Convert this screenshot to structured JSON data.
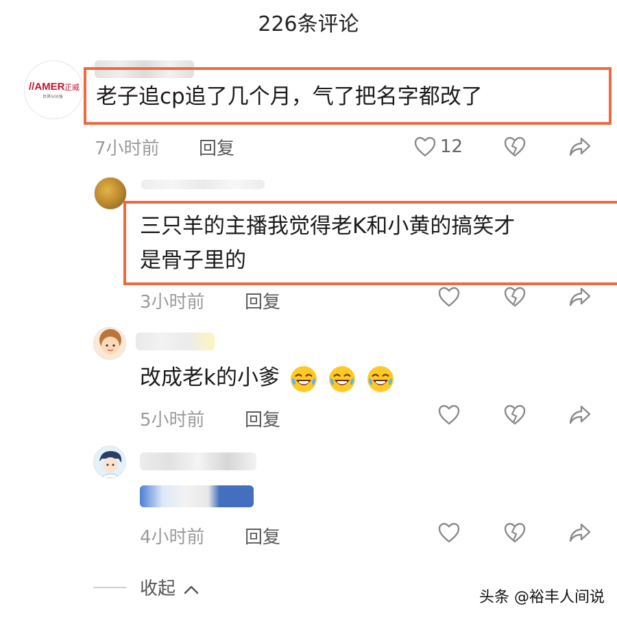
{
  "header": {
    "title": "226条评论"
  },
  "comments": [
    {
      "text": "老子追cp追了几个月，气了把名字都改了",
      "time": "7小时前",
      "reply": "回复",
      "likes": "12",
      "avatar_logo": "MER 正威",
      "avatar_sub": "世界500强"
    },
    {
      "line1": "三只羊的主播我觉得老K和小黄的搞笑才",
      "line2": "是骨子里的",
      "time": "3小时前",
      "reply": "回复"
    },
    {
      "text": "改成老k的小爹",
      "time": "5小时前",
      "reply": "回复",
      "emoji": "laughing-crying-emoji"
    },
    {
      "time": "4小时前",
      "reply": "回复"
    }
  ],
  "footer": {
    "collapse": "收起",
    "watermark": "头条 @裕丰人间说"
  },
  "colors": {
    "highlight": "#f0683d",
    "muted": "#9a9a9a"
  }
}
